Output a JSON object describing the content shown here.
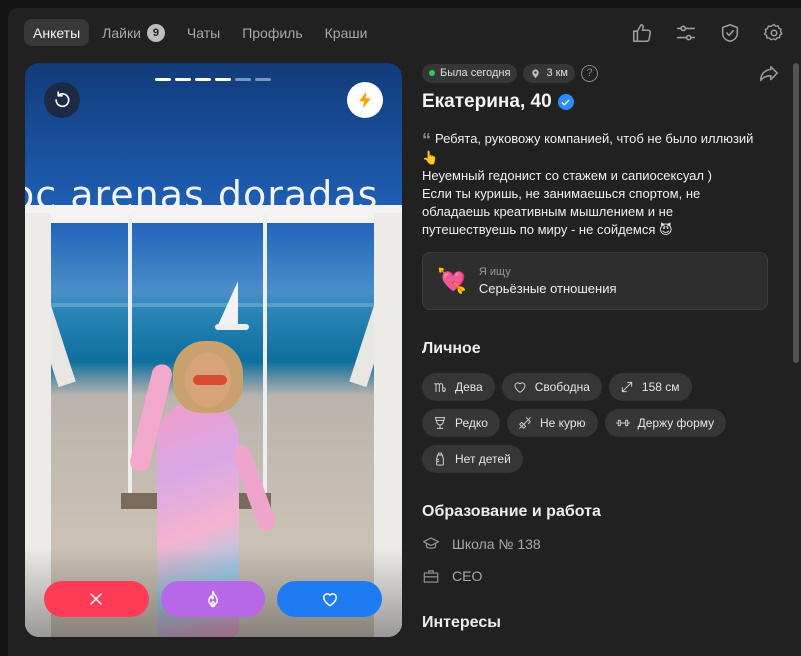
{
  "nav": {
    "tabs": [
      {
        "label": "Анкеты",
        "active": true
      },
      {
        "label": "Лайки",
        "badge": "9"
      },
      {
        "label": "Чаты"
      },
      {
        "label": "Профиль"
      },
      {
        "label": "Краши"
      }
    ]
  },
  "toolbar": {
    "icons": [
      "thumbs-up-icon",
      "sliders-icon",
      "shield-icon",
      "gear-icon"
    ]
  },
  "photo": {
    "overlay_text": "oc arenas doradas",
    "pages_total": 6,
    "pages_viewed": 4,
    "undo_icon": "undo-icon",
    "boost_icon": "lightning-icon",
    "actions": [
      "dislike-icon",
      "superlike-fire-icon",
      "like-heart-icon"
    ],
    "colors": {
      "dislike": "#ff3b55",
      "super": "#b768e6",
      "like": "#1f7bf2",
      "boost": "#f5a200"
    }
  },
  "profile": {
    "status": "Была сегодня",
    "distance": "3 км",
    "help": "?",
    "name": "Екатерина, 40",
    "verified": true,
    "bio": "Ребята, руковожу компанией, чтоб не было иллюзий 👆\nНеуемный гедонист со стажем и сапиосексуал )\nЕсли ты куришь, не занимаешься спортом, не обладаешь креативным мышлением и не путешествуешь по миру - не сойдемся 😈",
    "quote_mark": "“",
    "seeking": {
      "label": "Я ищу",
      "value": "Серьёзные отношения",
      "icon": "💘"
    },
    "personal": {
      "title": "Личное",
      "chips": [
        {
          "icon": "virgo-icon",
          "label": "Дева"
        },
        {
          "icon": "heart-outline-icon",
          "label": "Свободна"
        },
        {
          "icon": "height-icon",
          "label": "158 см"
        },
        {
          "icon": "wine-glass-icon",
          "label": "Редко"
        },
        {
          "icon": "no-smoking-icon",
          "label": "Не курю"
        },
        {
          "icon": "dumbbell-icon",
          "label": "Держу форму"
        },
        {
          "icon": "baby-bottle-icon",
          "label": "Нет детей"
        }
      ]
    },
    "work": {
      "title": "Образование и работа",
      "items": [
        {
          "icon": "graduation-cap-icon",
          "label": "Школа № 138"
        },
        {
          "icon": "briefcase-icon",
          "label": "CEO"
        }
      ]
    },
    "interests": {
      "title": "Интересы"
    }
  }
}
